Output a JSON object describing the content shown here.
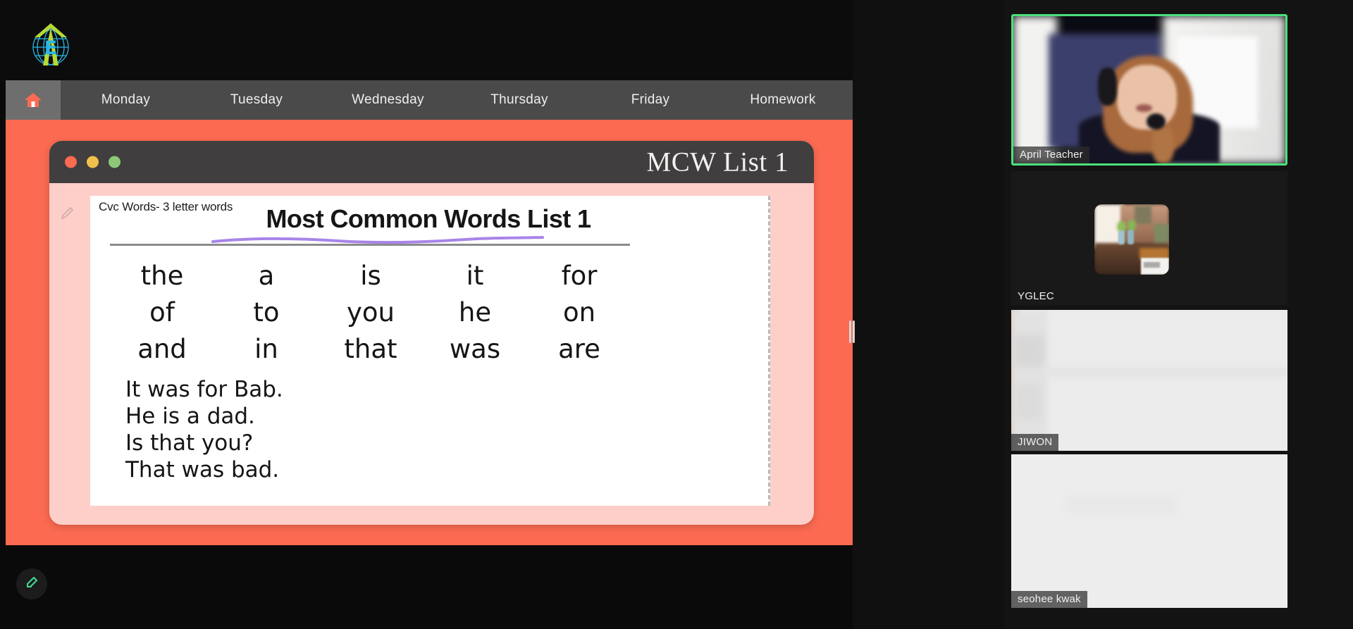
{
  "app": {
    "logo_alt": "YGLEC globe logo"
  },
  "nav": {
    "home_icon": "home-icon",
    "items": [
      {
        "label": "Monday"
      },
      {
        "label": "Tuesday"
      },
      {
        "label": "Wednesday"
      },
      {
        "label": "Thursday"
      },
      {
        "label": "Friday"
      },
      {
        "label": "Homework"
      }
    ]
  },
  "slide": {
    "window_title": "MCW List 1",
    "traffic_lights": [
      "close-red",
      "minimize-yellow",
      "maximize-green"
    ],
    "accent_color": "#fb6a51",
    "card_color": "#fdcfc8",
    "titlebar_color": "#403e3e"
  },
  "worksheet": {
    "corner_note": "Cvc Words- 3 letter words",
    "title": "Most Common Words List 1",
    "underline_color": "#a884e8",
    "words": [
      "the",
      "a",
      "is",
      "it",
      "for",
      "of",
      "to",
      "you",
      "he",
      "on",
      "and",
      "in",
      "that",
      "was",
      "are"
    ],
    "sentences": [
      "It was for Bab.",
      "He is a dad.",
      "Is that you?",
      "That was bad."
    ]
  },
  "toolbar": {
    "annotate_label": "pencil-icon",
    "annotate_color": "#3ddc97"
  },
  "participants": [
    {
      "name": "April Teacher",
      "speaking": true,
      "border_color": "#4ce07a"
    },
    {
      "name": "YGLEC",
      "speaking": false,
      "border_color": ""
    },
    {
      "name": "JIWON",
      "speaking": false,
      "border_color": ""
    },
    {
      "name": "seohee kwak",
      "speaking": false,
      "border_color": ""
    }
  ]
}
